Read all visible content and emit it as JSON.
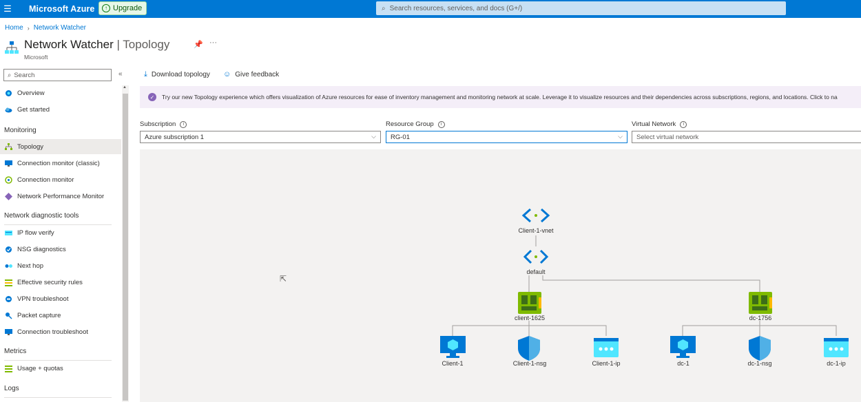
{
  "topbar": {
    "brand": "Microsoft Azure",
    "upgrade_label": "Upgrade",
    "search_placeholder": "Search resources, services, and docs (G+/)"
  },
  "breadcrumb": {
    "home": "Home",
    "current": "Network Watcher"
  },
  "header": {
    "title_main": "Network Watcher",
    "title_sep": " | ",
    "title_sub": "Topology",
    "subtitle": "Microsoft"
  },
  "sidebar": {
    "search_placeholder": "Search",
    "items_top": [
      {
        "label": "Overview",
        "icon": "globe-icon"
      },
      {
        "label": "Get started",
        "icon": "cloud-icon"
      }
    ],
    "sections": [
      {
        "title": "Monitoring",
        "items": [
          {
            "label": "Topology",
            "icon": "topology-icon",
            "active": true
          },
          {
            "label": "Connection monitor (classic)",
            "icon": "monitor-icon"
          },
          {
            "label": "Connection monitor",
            "icon": "connection-icon"
          },
          {
            "label": "Network Performance Monitor",
            "icon": "diamond-icon"
          }
        ]
      },
      {
        "title": "Network diagnostic tools",
        "items": [
          {
            "label": "IP flow verify",
            "icon": "ip-flow-icon"
          },
          {
            "label": "NSG diagnostics",
            "icon": "nsg-icon"
          },
          {
            "label": "Next hop",
            "icon": "next-hop-icon"
          },
          {
            "label": "Effective security rules",
            "icon": "rules-icon"
          },
          {
            "label": "VPN troubleshoot",
            "icon": "vpn-icon"
          },
          {
            "label": "Packet capture",
            "icon": "packet-icon"
          },
          {
            "label": "Connection troubleshoot",
            "icon": "troubleshoot-icon"
          }
        ]
      },
      {
        "title": "Metrics",
        "items": [
          {
            "label": "Usage + quotas",
            "icon": "quota-icon"
          }
        ]
      },
      {
        "title": "Logs",
        "items": []
      }
    ]
  },
  "commands": {
    "download": "Download topology",
    "feedback": "Give feedback"
  },
  "banner": {
    "text": "Try our new Topology experience which offers visualization of Azure resources for ease of inventory management and monitoring network at scale. Leverage it to visualize resources and their dependencies across subscriptions, regions, and locations. Click to na"
  },
  "filters": {
    "subscription": {
      "label": "Subscription",
      "value": "Azure subscription 1"
    },
    "resource_group": {
      "label": "Resource Group",
      "value": "RG-01"
    },
    "virtual_network": {
      "label": "Virtual Network",
      "placeholder": "Select virtual network"
    }
  },
  "topology": {
    "vnet": "Client-1-vnet",
    "subnet": "default",
    "nics": [
      "client-1625",
      "dc-1756"
    ],
    "client_children": [
      "Client-1",
      "Client-1-nsg",
      "Client-1-ip"
    ],
    "dc_children": [
      "dc-1",
      "dc-1-nsg",
      "dc-1-ip"
    ]
  },
  "colors": {
    "azure_blue": "#0078d4",
    "nic_green": "#7fba00",
    "banner_purple": "#8764b8"
  }
}
